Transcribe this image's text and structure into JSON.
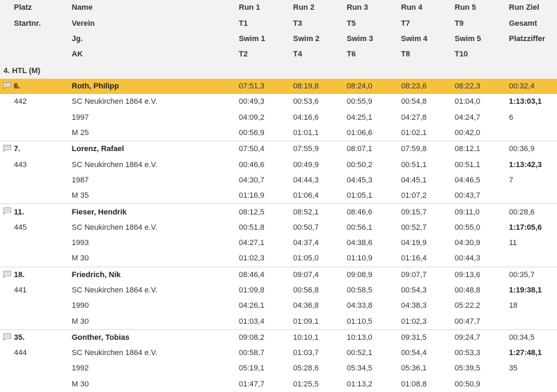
{
  "header": {
    "rows": [
      [
        "Platz",
        "Name",
        "Run 1",
        "Run 2",
        "Run 3",
        "Run 4",
        "Run 5",
        "Run Ziel"
      ],
      [
        "Startnr.",
        "Verein",
        "T1",
        "T3",
        "T5",
        "T7",
        "T9",
        "Gesamt"
      ],
      [
        "",
        "Jg.",
        "Swim 1",
        "Swim 2",
        "Swim 3",
        "Swim 4",
        "Swim 5",
        "Platzziffer"
      ],
      [
        "",
        "AK",
        "T2",
        "T4",
        "T6",
        "T8",
        "T10",
        ""
      ]
    ]
  },
  "group": {
    "title": "4. HTL (M)"
  },
  "colors": {
    "highlight": "#f6c23e",
    "header_bg": "#f2f2f2"
  },
  "athletes": [
    {
      "place": "6.",
      "startnr": "442",
      "name": "Roth, Philipp",
      "club": "SC Neukirchen 1864 e.V.",
      "year": "1997",
      "ak": "M 25",
      "highlighted": true,
      "note_icon": "comment-icon",
      "runs": [
        "07:51,3",
        "08:19,8",
        "08:24,0",
        "08:23,6",
        "08:22,3",
        "00:32,4"
      ],
      "transitions": [
        "00:49,3",
        "00:53,6",
        "00:55,9",
        "00:54,8",
        "01:04,0"
      ],
      "total": "1:13:03,1",
      "swims": [
        "04:09,2",
        "04:16,6",
        "04:25,1",
        "04:27,8",
        "04:24,7"
      ],
      "platzziffer": "6",
      "t_even": [
        "00:56,9",
        "01:01,1",
        "01:06,6",
        "01:02,1",
        "00:42,0"
      ]
    },
    {
      "place": "7.",
      "startnr": "443",
      "name": "Lorenz, Rafael",
      "club": "SC Neukirchen 1864 e.V.",
      "year": "1987",
      "ak": "M 35",
      "highlighted": false,
      "note_icon": "comment-icon",
      "runs": [
        "07:50,4",
        "07:55,9",
        "08:07,1",
        "07:59,8",
        "08:12,1",
        "00:36,9"
      ],
      "transitions": [
        "00:46,6",
        "00:49,9",
        "00:50,2",
        "00:51,1",
        "00:51,1"
      ],
      "total": "1:13:42,3",
      "swims": [
        "04:30,7",
        "04:44,3",
        "04:45,3",
        "04:45,1",
        "04:46,5"
      ],
      "platzziffer": "7",
      "t_even": [
        "01:16,9",
        "01:06,4",
        "01:05,1",
        "01:07,2",
        "00:43,7"
      ]
    },
    {
      "place": "11.",
      "startnr": "445",
      "name": "Fieser, Hendrik",
      "club": "SC Neukirchen 1864 e.V.",
      "year": "1993",
      "ak": "M 30",
      "highlighted": false,
      "note_icon": "comment-icon",
      "runs": [
        "08:12,5",
        "08:52,1",
        "08:46,6",
        "09:15,7",
        "09:11,0",
        "00:28,6"
      ],
      "transitions": [
        "00:51,8",
        "00:50,7",
        "00:56,1",
        "00:52,7",
        "00:55,0"
      ],
      "total": "1:17:05,6",
      "swims": [
        "04:27,1",
        "04:37,4",
        "04:38,6",
        "04:19,9",
        "04:30,9"
      ],
      "platzziffer": "11",
      "t_even": [
        "01:02,3",
        "01:05,0",
        "01:10,9",
        "01:16,4",
        "00:44,3"
      ]
    },
    {
      "place": "18.",
      "startnr": "441",
      "name": "Friedrich, Nik",
      "club": "SC Neukirchen 1864 e.V.",
      "year": "1990",
      "ak": "M 30",
      "highlighted": false,
      "note_icon": "comment-icon",
      "runs": [
        "08:46,4",
        "09:07,4",
        "09:08,9",
        "09:07,7",
        "09:13,6",
        "00:35,7"
      ],
      "transitions": [
        "01:09,8",
        "00:56,8",
        "00:58,5",
        "00:54,3",
        "00:48,8"
      ],
      "total": "1:19:38,1",
      "swims": [
        "04:26,1",
        "04:36,8",
        "04:33,8",
        "04:38,3",
        "05:22,2"
      ],
      "platzziffer": "18",
      "t_even": [
        "01:03,4",
        "01:09,1",
        "01:10,5",
        "01:02,3",
        "00:47,7"
      ]
    },
    {
      "place": "35.",
      "startnr": "444",
      "name": "Gonther, Tobias",
      "club": "SC Neukirchen 1864 e.V.",
      "year": "1992",
      "ak": "M 30",
      "highlighted": false,
      "note_icon": "comment-icon",
      "runs": [
        "09:08,2",
        "10:10,1",
        "10:13,0",
        "09:31,5",
        "09:24,7",
        "00:34,5"
      ],
      "transitions": [
        "00:58,7",
        "01:03,7",
        "00:52,1",
        "00:54,4",
        "00:53,3"
      ],
      "total": "1:27:48,1",
      "swims": [
        "05:19,1",
        "05:28,6",
        "05:34,5",
        "05:36,1",
        "05:39,5"
      ],
      "platzziffer": "35",
      "t_even": [
        "01:47,7",
        "01:25,5",
        "01:13,2",
        "01:08,8",
        "00:50,9"
      ]
    }
  ]
}
